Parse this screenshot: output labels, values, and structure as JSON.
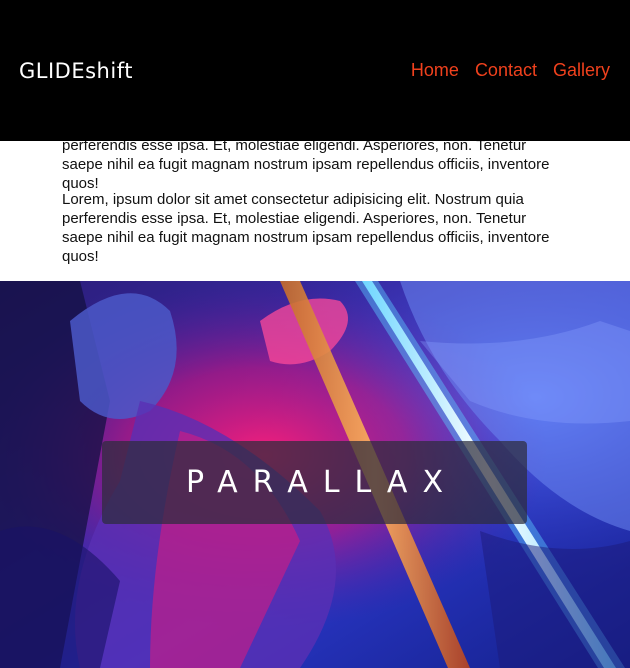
{
  "header": {
    "logo": "GLIDEshift",
    "nav": [
      {
        "label": "Home"
      },
      {
        "label": "Contact"
      },
      {
        "label": "Gallery"
      }
    ]
  },
  "content": {
    "paragraphs": [
      "Lorem, ipsum dolor sit amet consectetur adipisicing elit. Nostrum quia perferendis esse ipsa. Et, molestiae eligendi. Asperiores, non. Tenetur saepe nihil ea fugit magnam nostrum ipsam repellendus officiis, inventore quos!",
      "Lorem, ipsum dolor sit amet consectetur adipisicing elit. Nostrum quia perferendis esse ipsa. Et, molestiae eligendi. Asperiores, non. Tenetur saepe nihil ea fugit magnam nostrum ipsam repellendus officiis, inventore quos!"
    ]
  },
  "hero": {
    "caption": "PARALLAX",
    "image_description_icon": "neon-light-portrait-image"
  },
  "colors": {
    "header_bg": "#000000",
    "nav_link": "#f0411d",
    "logo": "#ffffff",
    "body_text": "#111111"
  }
}
